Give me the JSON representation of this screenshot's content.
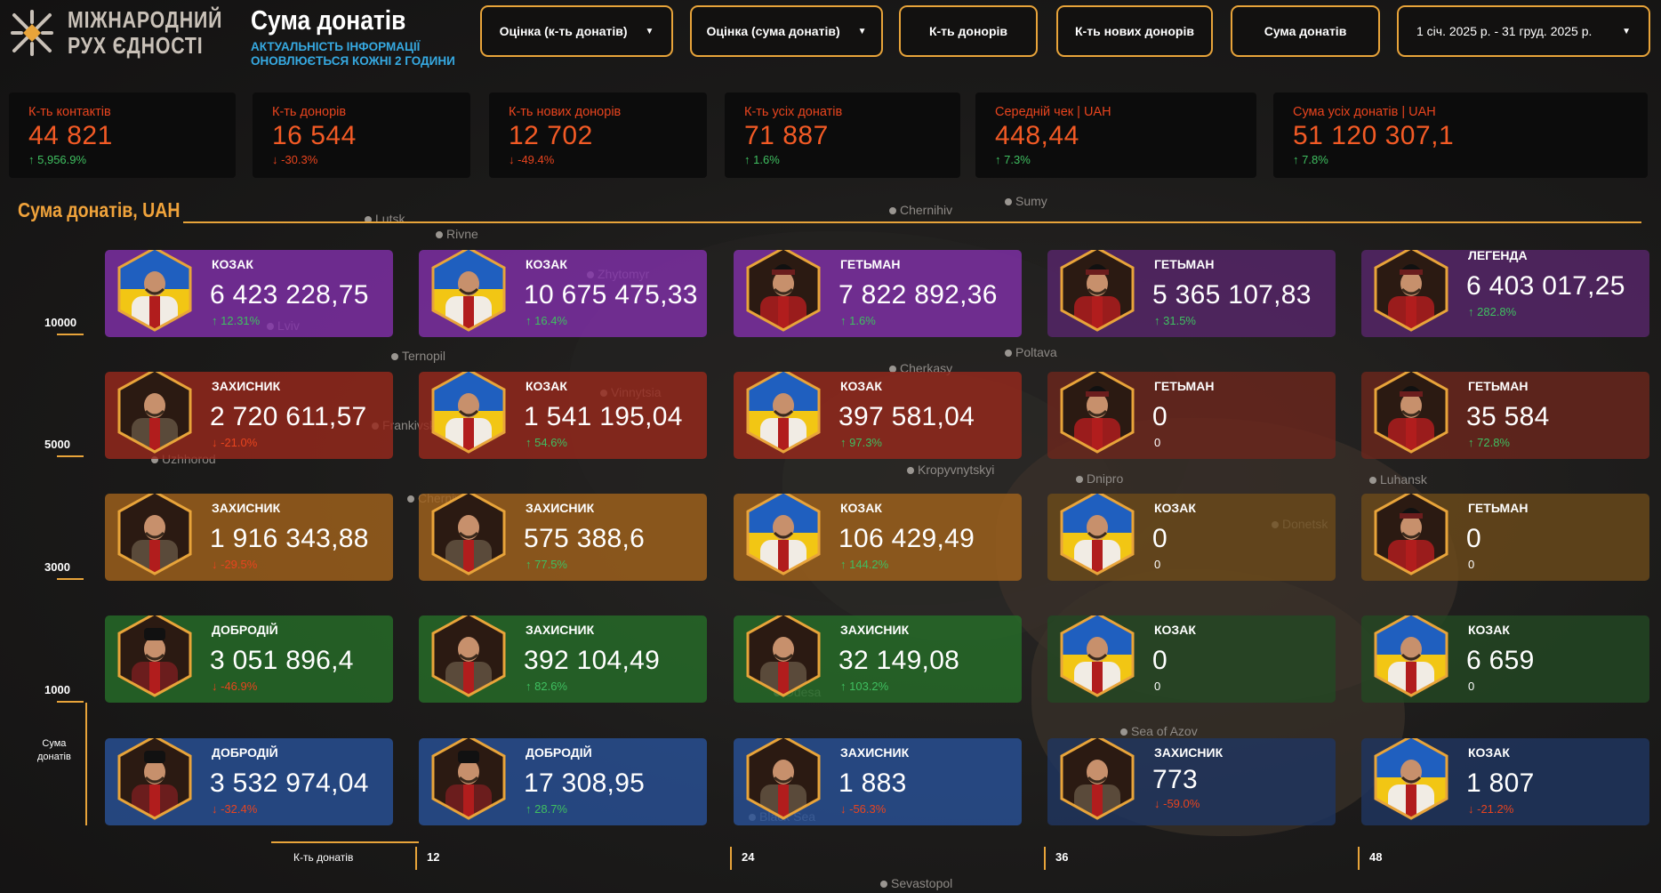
{
  "header": {
    "logo_line1": "МІЖНАРОДНИЙ",
    "logo_line2": "РУХ ЄДНОСТІ",
    "title": "Сума донатів",
    "subtitle_line1": "АКТУАЛЬНІСТЬ ІНФОРМАЦІЇ",
    "subtitle_line2": "ОНОВЛЮЄТЬСЯ КОЖНІ 2 ГОДИНИ",
    "buttons": [
      {
        "label": "Оцінка (к-ть донатів)",
        "dropdown": true
      },
      {
        "label": "Оцінка (сума донатів)",
        "dropdown": true
      },
      {
        "label": "К-ть донорів",
        "dropdown": false
      },
      {
        "label": "К-ть нових донорів",
        "dropdown": false
      },
      {
        "label": "Сума донатів",
        "dropdown": false
      }
    ],
    "date_range": "1 січ. 2025 р. - 31 груд. 2025 р."
  },
  "kpis": [
    {
      "label": "К-ть контактів",
      "value": "44 821",
      "delta": "5,956.9%",
      "trend": "up"
    },
    {
      "label": "К-ть донорів",
      "value": "16 544",
      "delta": "-30.3%",
      "trend": "down"
    },
    {
      "label": "К-ть нових донорів",
      "value": "12 702",
      "delta": "-49.4%",
      "trend": "down"
    },
    {
      "label": "К-ть усіх донатів",
      "value": "71 887",
      "delta": "1.6%",
      "trend": "up"
    },
    {
      "label": "Середній чек | UAH",
      "value": "448,44",
      "delta": "7.3%",
      "trend": "up"
    },
    {
      "label": "Сума усіх донатів | UAH",
      "value": "51 120 307,1",
      "delta": "7.8%",
      "trend": "up"
    }
  ],
  "section_title": "Сума донатів, UAH",
  "y_axis": {
    "ticks": [
      "10000",
      "5000",
      "3000",
      "1000"
    ],
    "label_line1": "Сума",
    "label_line2": "донатів"
  },
  "x_axis": {
    "label": "К-ть донатів",
    "ticks": [
      "12",
      "24",
      "36",
      "48"
    ]
  },
  "map_labels": [
    "Lutsk",
    "Rivne",
    "Zhytomyr",
    "Chernihiv",
    "Sumy",
    "Lviv",
    "Ternopil",
    "Poltava",
    "Cherkasy",
    "Vinnytsia",
    "Frankivsk",
    "Uzhhorod",
    "Kropyvnytskyi",
    "Dnipro",
    "Luhansk",
    "Donetsk",
    "Chernivtsi",
    "Odesa",
    "Sea of Azov",
    "Black Sea",
    "Sevastopol"
  ],
  "rows": [
    {
      "color": "purple",
      "cards": [
        {
          "tier": "КОЗАК",
          "avatar": "kozak",
          "amount": "6 423 228,75",
          "delta": "12.31%",
          "trend": "up"
        },
        {
          "tier": "КОЗАК",
          "avatar": "kozak",
          "amount": "10 675 475,33",
          "delta": "16.4%",
          "trend": "up"
        },
        {
          "tier": "ГЕТЬМАН",
          "avatar": "hetman",
          "amount": "7 822 892,36",
          "delta": "1.6%",
          "trend": "up"
        },
        {
          "tier": "ГЕТЬМАН",
          "avatar": "hetman",
          "amount": "5 365 107,83",
          "delta": "31.5%",
          "trend": "up"
        },
        {
          "tier": "ЛЕГЕНДА",
          "avatar": "hetman",
          "amount": "6 403 017,25",
          "delta": "282.8%",
          "trend": "up"
        }
      ]
    },
    {
      "color": "red",
      "cards": [
        {
          "tier": "ЗАХИСНИК",
          "avatar": "zakhysnyk",
          "amount": "2 720 611,57",
          "delta": "-21.0%",
          "trend": "down"
        },
        {
          "tier": "КОЗАК",
          "avatar": "kozak",
          "amount": "1 541 195,04",
          "delta": "54.6%",
          "trend": "up"
        },
        {
          "tier": "КОЗАК",
          "avatar": "kozak",
          "amount": "397 581,04",
          "delta": "97.3%",
          "trend": "up"
        },
        {
          "tier": "ГЕТЬМАН",
          "avatar": "hetman",
          "amount": "0",
          "delta": "0",
          "trend": "none"
        },
        {
          "tier": "ГЕТЬМАН",
          "avatar": "hetman",
          "amount": "35 584",
          "delta": "72.8%",
          "trend": "up"
        }
      ]
    },
    {
      "color": "orange",
      "cards": [
        {
          "tier": "ЗАХИСНИК",
          "avatar": "zakhysnyk",
          "amount": "1 916 343,88",
          "delta": "-29.5%",
          "trend": "down"
        },
        {
          "tier": "ЗАХИСНИК",
          "avatar": "zakhysnyk",
          "amount": "575 388,6",
          "delta": "77.5%",
          "trend": "up"
        },
        {
          "tier": "КОЗАК",
          "avatar": "kozak",
          "amount": "106 429,49",
          "delta": "144.2%",
          "trend": "up"
        },
        {
          "tier": "КОЗАК",
          "avatar": "kozak",
          "amount": "0",
          "delta": "0",
          "trend": "none"
        },
        {
          "tier": "ГЕТЬМАН",
          "avatar": "hetman",
          "amount": "0",
          "delta": "0",
          "trend": "none"
        }
      ]
    },
    {
      "color": "green",
      "cards": [
        {
          "tier": "ДОБРОДІЙ",
          "avatar": "dobrodii",
          "amount": "3 051 896,4",
          "delta": "-46.9%",
          "trend": "down"
        },
        {
          "tier": "ЗАХИСНИК",
          "avatar": "zakhysnyk",
          "amount": "392 104,49",
          "delta": "82.6%",
          "trend": "up"
        },
        {
          "tier": "ЗАХИСНИК",
          "avatar": "zakhysnyk",
          "amount": "32 149,08",
          "delta": "103.2%",
          "trend": "up"
        },
        {
          "tier": "КОЗАК",
          "avatar": "kozak",
          "amount": "0",
          "delta": "0",
          "trend": "none"
        },
        {
          "tier": "КОЗАК",
          "avatar": "kozak",
          "amount": "6 659",
          "delta": "0",
          "trend": "none"
        }
      ]
    },
    {
      "color": "blue",
      "cards": [
        {
          "tier": "ДОБРОДІЙ",
          "avatar": "dobrodii",
          "amount": "3 532 974,04",
          "delta": "-32.4%",
          "trend": "down"
        },
        {
          "tier": "ДОБРОДІЙ",
          "avatar": "dobrodii",
          "amount": "17 308,95",
          "delta": "28.7%",
          "trend": "up"
        },
        {
          "tier": "ЗАХИСНИК",
          "avatar": "zakhysnyk",
          "amount": "1 883",
          "delta": "-56.3%",
          "trend": "down"
        },
        {
          "tier": "ЗАХИСНИК",
          "avatar": "zakhysnyk",
          "amount": "773",
          "delta": "-59.0%",
          "trend": "down"
        },
        {
          "tier": "КОЗАК",
          "avatar": "kozak",
          "amount": "1 807",
          "delta": "-21.2%",
          "trend": "down"
        }
      ]
    }
  ],
  "colors": {
    "accent": "#e8a43a",
    "kpi_value": "#f25a25",
    "up": "#3fbf60",
    "down": "#e8441e",
    "subtitle": "#36a9e1"
  }
}
